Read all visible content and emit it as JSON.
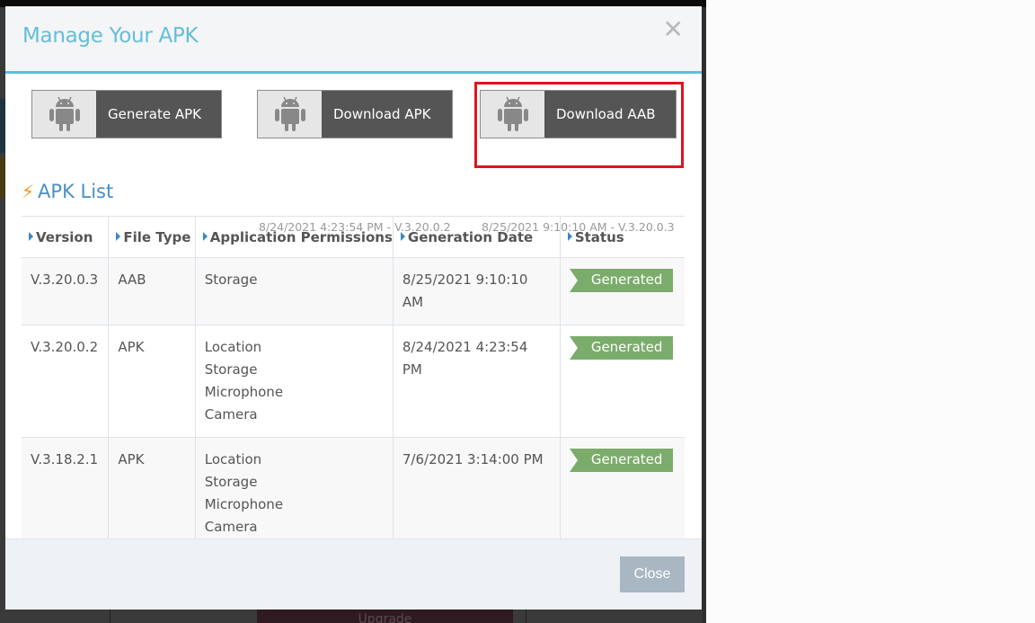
{
  "background": {
    "upgrade_label": "Upgrade"
  },
  "modal": {
    "title": "Manage Your APK",
    "close_icon": "close-x-icon",
    "actions": [
      {
        "label": "Generate APK",
        "icon": "android-icon",
        "subtext": ""
      },
      {
        "label": "Download APK",
        "icon": "android-icon",
        "subtext": "8/24/2021 4:23:54 PM - V.3.20.0.2"
      },
      {
        "label": "Download AAB",
        "icon": "android-icon",
        "subtext": "8/25/2021 9:10:10 AM - V.3.20.0.3",
        "highlighted": true
      }
    ],
    "section_title": "APK List",
    "section_icon": "lightning-bolt-icon",
    "table": {
      "headers": [
        "Version",
        "File Type",
        "Application Permissions",
        "Generation Date",
        "Status"
      ],
      "rows": [
        {
          "version": "V.3.20.0.3",
          "file_type": "AAB",
          "permissions": [
            "Storage"
          ],
          "date": "8/25/2021 9:10:10 AM",
          "status": "Generated"
        },
        {
          "version": "V.3.20.0.2",
          "file_type": "APK",
          "permissions": [
            "Location",
            "Storage",
            "Microphone",
            "Camera"
          ],
          "date": "8/24/2021 4:23:54 PM",
          "status": "Generated"
        },
        {
          "version": "V.3.18.2.1",
          "file_type": "APK",
          "permissions": [
            "Location",
            "Storage",
            "Microphone",
            "Camera"
          ],
          "date": "7/6/2021 3:14:00 PM",
          "status": "Generated"
        }
      ]
    },
    "footer": {
      "close_label": "Close"
    }
  },
  "colors": {
    "title": "#62bfd9",
    "header_accent": "#5bc0de",
    "highlight": "#e0131f",
    "status_generated": "#7bac6b",
    "section_title": "#4a8ec8",
    "bolt": "#f7941d",
    "close_button": "#a8b7c2"
  }
}
